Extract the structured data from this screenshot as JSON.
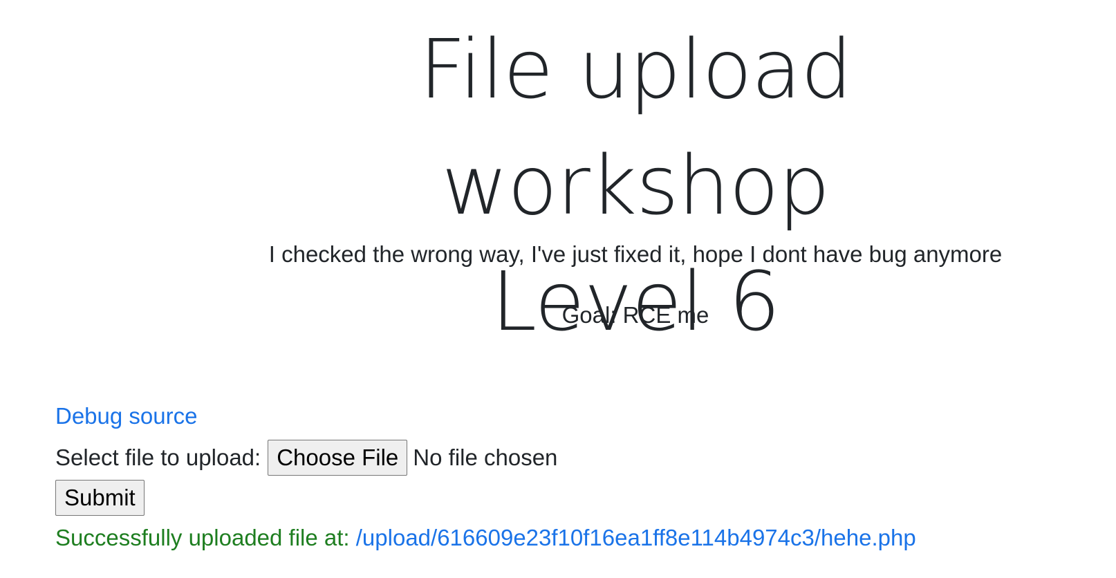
{
  "header": {
    "title_line1": "File upload workshop",
    "title_line2": "Level 6",
    "description": "I checked the wrong way, I've just fixed it, hope I dont have bug anymore",
    "goal": "Goal: RCE me"
  },
  "links": {
    "debug_source": "Debug source"
  },
  "upload_form": {
    "select_label": "Select file to upload:",
    "choose_file_label": "Choose File",
    "no_file_text": "No file chosen",
    "submit_label": "Submit"
  },
  "result": {
    "message": "Successfully uploaded file at: ",
    "path": "/upload/616609e23f10f16ea1ff8e114b4974c3/hehe.php"
  }
}
